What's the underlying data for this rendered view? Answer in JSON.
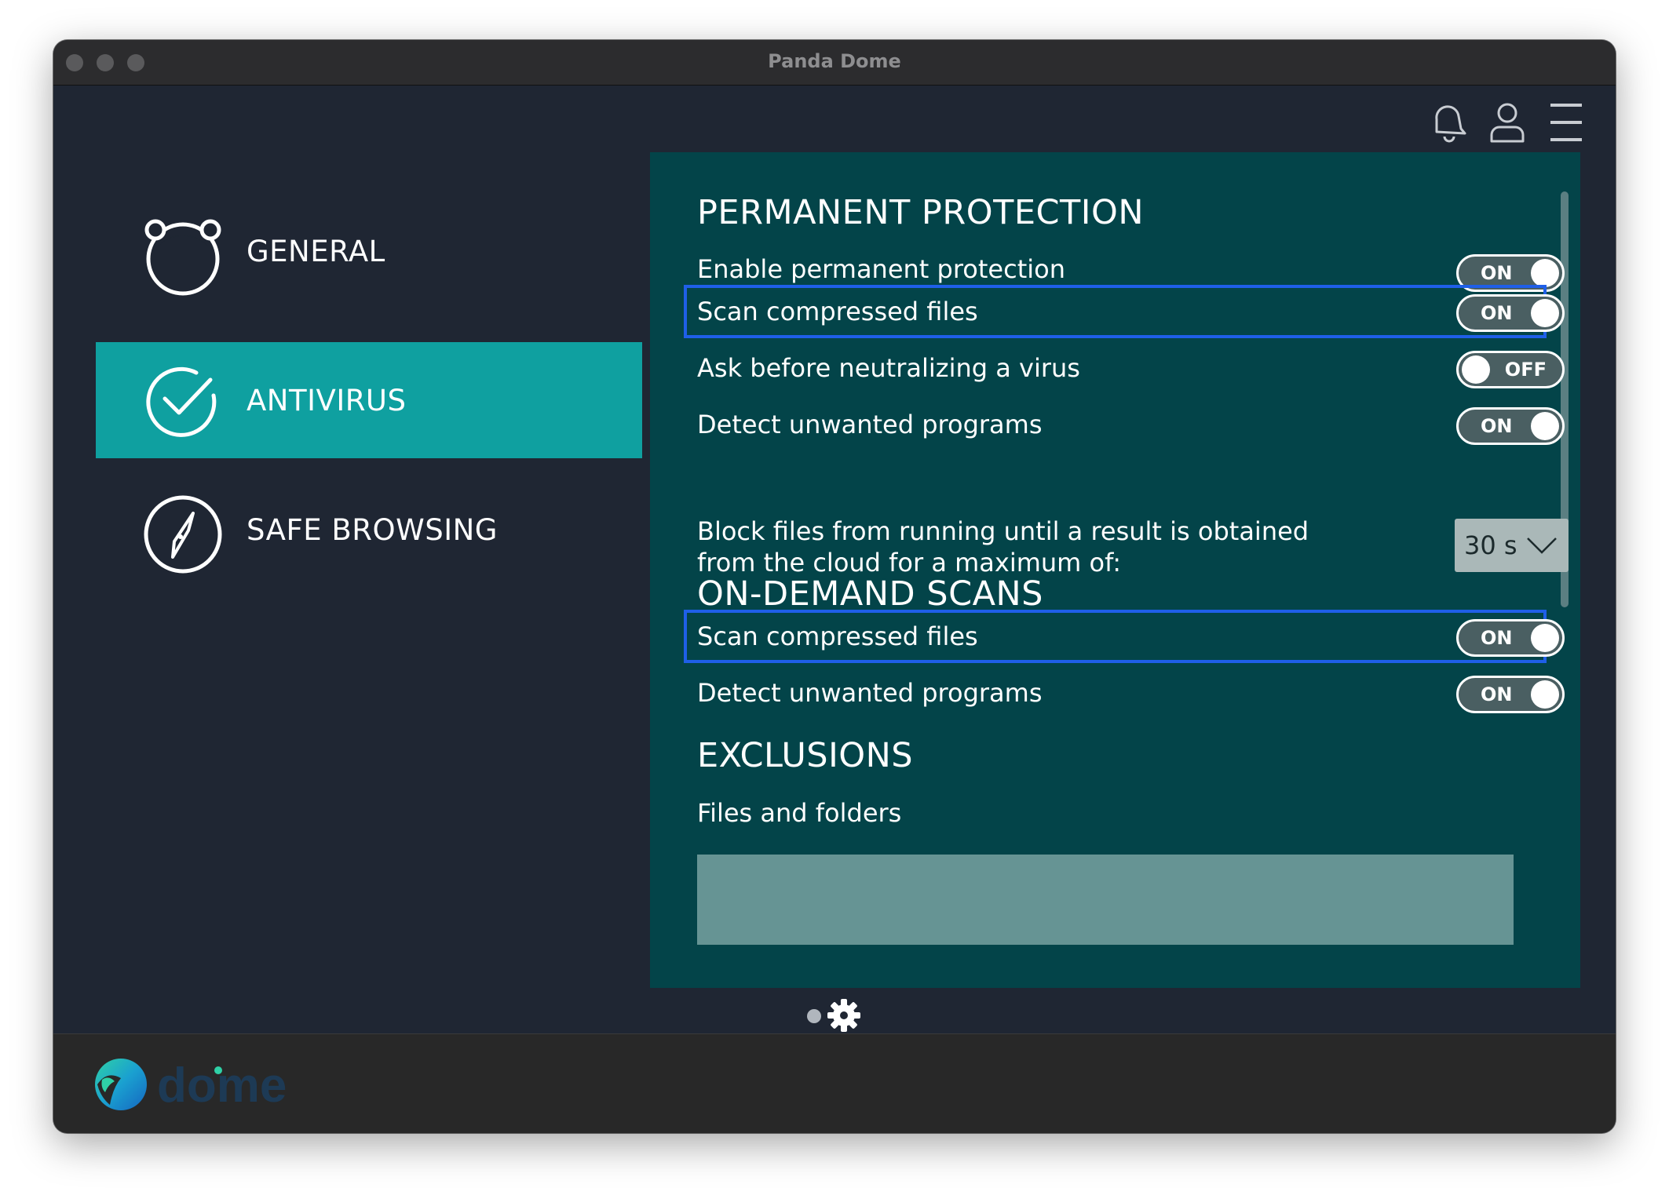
{
  "window": {
    "title": "Panda Dome"
  },
  "header_icons": [
    "bell-icon",
    "user-icon",
    "menu-icon"
  ],
  "sidebar": {
    "items": [
      {
        "label": "GENERAL",
        "icon": "panda-icon",
        "active": false
      },
      {
        "label": "ANTIVIRUS",
        "icon": "check-circle-icon",
        "active": true
      },
      {
        "label": "SAFE BROWSING",
        "icon": "compass-icon",
        "active": false
      }
    ]
  },
  "panel": {
    "permanent": {
      "title": "PERMANENT PROTECTION",
      "enable": {
        "label": "Enable permanent protection",
        "state": "ON"
      },
      "scan_compressed": {
        "label": "Scan compressed files",
        "state": "ON"
      },
      "ask_before": {
        "label": "Ask before neutralizing a virus",
        "state": "OFF"
      },
      "detect_unwanted": {
        "label": "Detect unwanted programs",
        "state": "ON"
      },
      "block_files": {
        "label_line1": "Block files from running until a result is obtained",
        "label_line2": "from the cloud for a maximum of:",
        "value": "30 s"
      }
    },
    "on_demand": {
      "title": "ON-DEMAND SCANS",
      "scan_compressed": {
        "label": "Scan compressed files",
        "state": "ON"
      },
      "detect_unwanted": {
        "label": "Detect unwanted programs",
        "state": "ON"
      }
    },
    "exclusions": {
      "title": "EXCLUSIONS",
      "files_folders": "Files and folders"
    }
  },
  "colors": {
    "sidebar_bg": "#1f2633",
    "active_nav": "#0fa0a0",
    "panel_bg": "#034449",
    "highlight": "#1f5fe8",
    "exclusion_box": "#669494"
  }
}
